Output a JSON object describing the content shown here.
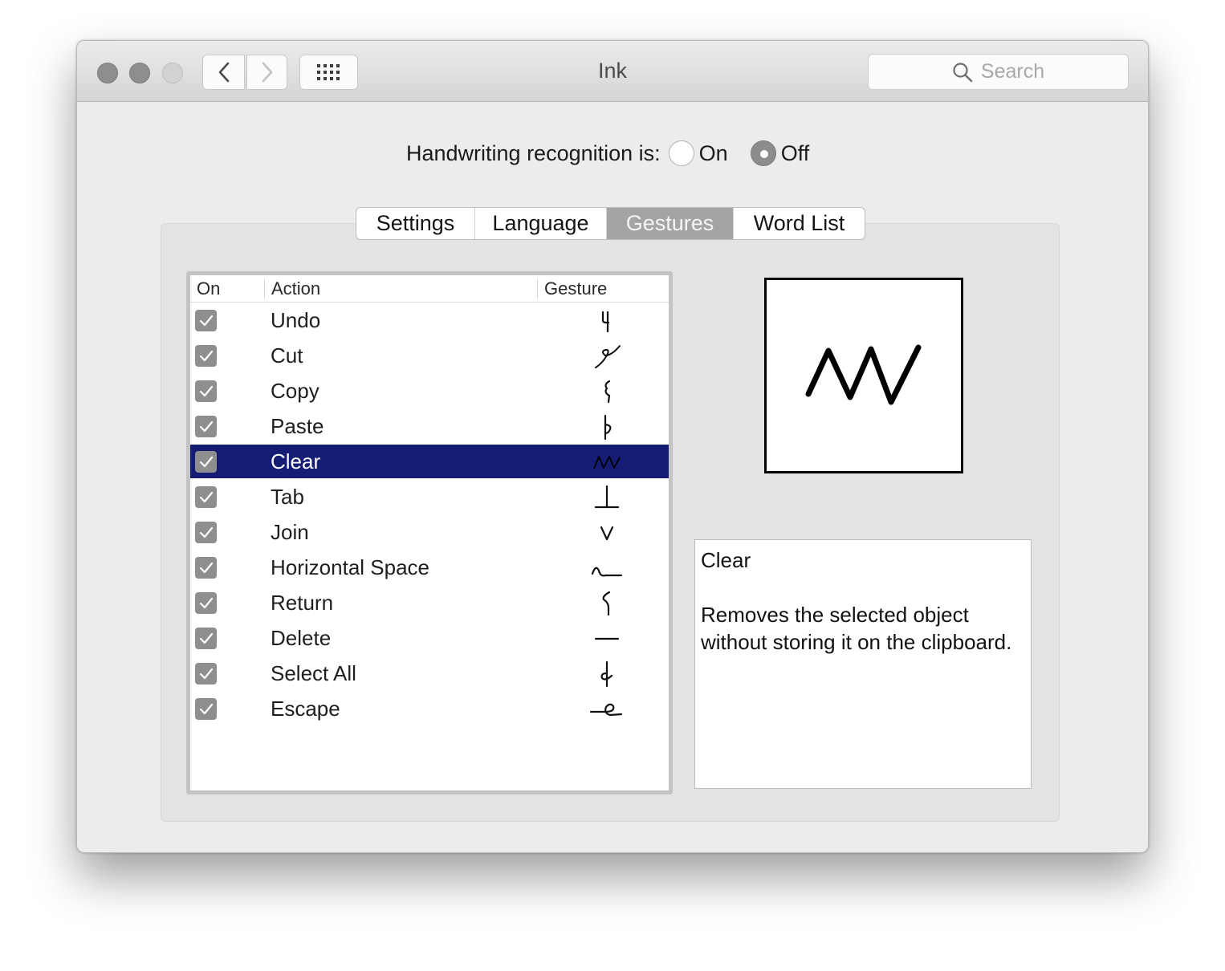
{
  "window": {
    "title": "Ink"
  },
  "toolbar": {
    "back_icon": "chevron-left-icon",
    "forward_icon": "chevron-right-icon",
    "grid_icon": "show-all-grid-icon",
    "search_placeholder": "Search"
  },
  "recognition": {
    "label": "Handwriting recognition is:",
    "on_label": "On",
    "off_label": "Off",
    "selected": "Off"
  },
  "tabs": [
    {
      "label": "Settings",
      "active": false
    },
    {
      "label": "Language",
      "active": false
    },
    {
      "label": "Gestures",
      "active": true
    },
    {
      "label": "Word List",
      "active": false
    }
  ],
  "gestures_table": {
    "columns": {
      "on": "On",
      "action": "Action",
      "gesture": "Gesture"
    },
    "rows": [
      {
        "on": true,
        "action": "Undo",
        "selected": false
      },
      {
        "on": true,
        "action": "Cut",
        "selected": false
      },
      {
        "on": true,
        "action": "Copy",
        "selected": false
      },
      {
        "on": true,
        "action": "Paste",
        "selected": false
      },
      {
        "on": true,
        "action": "Clear",
        "selected": true
      },
      {
        "on": true,
        "action": "Tab",
        "selected": false
      },
      {
        "on": true,
        "action": "Join",
        "selected": false
      },
      {
        "on": true,
        "action": "Horizontal Space",
        "selected": false
      },
      {
        "on": true,
        "action": "Return",
        "selected": false
      },
      {
        "on": true,
        "action": "Delete",
        "selected": false
      },
      {
        "on": true,
        "action": "Select All",
        "selected": false
      },
      {
        "on": true,
        "action": "Escape",
        "selected": false
      }
    ]
  },
  "detail": {
    "title": "Clear",
    "description": "Removes the selected object without storing it on the clipboard."
  },
  "colors": {
    "selection": "#141c74",
    "active_tab": "#a4a4a4",
    "checkbox": "#8e8e8e"
  }
}
